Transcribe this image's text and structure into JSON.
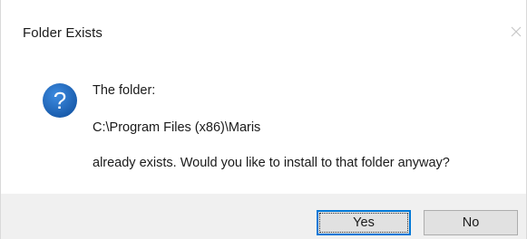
{
  "dialog": {
    "title": "Folder Exists",
    "close_icon": "close-icon",
    "icon": "question-icon",
    "icon_color": "#1e6dc0",
    "message": {
      "line1": "The folder:",
      "line2": "C:\\Program Files (x86)\\Maris",
      "line3": "already exists. Would you like to install to that folder anyway?"
    },
    "buttons": {
      "yes_label": "Yes",
      "no_label": "No"
    },
    "accent_color": "#0078d7"
  }
}
